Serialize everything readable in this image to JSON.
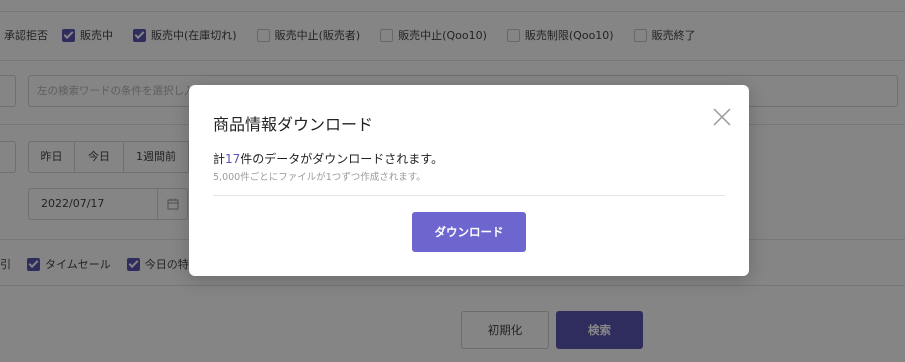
{
  "status_filter": {
    "partial_label": "承認拒否",
    "options": [
      {
        "label": "販売中",
        "checked": true
      },
      {
        "label": "販売中(在庫切れ)",
        "checked": true
      },
      {
        "label": "販売中止(販売者)",
        "checked": false
      },
      {
        "label": "販売中止(Qoo10)",
        "checked": false
      },
      {
        "label": "販売制限(Qoo10)",
        "checked": false
      },
      {
        "label": "販売終了",
        "checked": false
      }
    ]
  },
  "search": {
    "placeholder": "左の検索ワードの条件を選択し入"
  },
  "date_filter": {
    "quick_buttons": [
      "昨日",
      "今日",
      "1週間前"
    ],
    "date_value": "2022/07/17"
  },
  "option_filter": {
    "partial_label": "引",
    "options": [
      {
        "label": "タイムセール",
        "checked": true
      },
      {
        "label": "今日の特",
        "checked": true
      }
    ]
  },
  "actions": {
    "reset_label": "初期化",
    "search_label": "検索"
  },
  "modal": {
    "title": "商品情報ダウンロード",
    "message_prefix": "計",
    "count": "17",
    "message_suffix": "件のデータがダウンロードされます。",
    "sub_message": "5,000件ごとにファイルが1つずつ作成されます。",
    "download_label": "ダウンロード",
    "close_icon": "close-icon"
  },
  "colors": {
    "accent": "#5b55b5",
    "modal_button": "#6e66cf",
    "overlay": "rgba(0,0,0,0.48)"
  }
}
